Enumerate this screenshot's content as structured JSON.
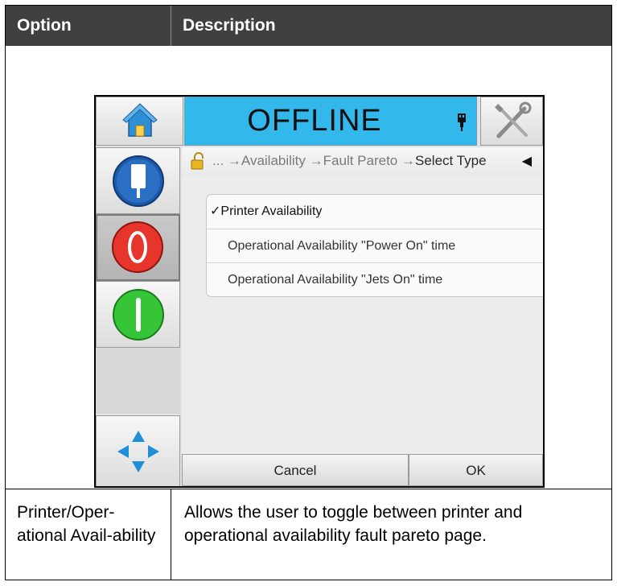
{
  "table": {
    "header_option": "Option",
    "header_description": "Description",
    "rows": [
      {
        "option": "Printer/Oper-ational Avail-ability",
        "description": "Allows the user to toggle between printer and operational availability fault pareto page."
      }
    ]
  },
  "screen": {
    "status": "OFFLINE",
    "breadcrumb": {
      "prefix": "...",
      "items": [
        "Availability",
        "Fault Pareto"
      ],
      "current": "Select Type"
    },
    "options": [
      {
        "label": "Printer Availability",
        "selected": true
      },
      {
        "label": "Operational Availability \"Power On\" time",
        "selected": false
      },
      {
        "label": "Operational Availability \"Jets On\" time",
        "selected": false
      }
    ],
    "check_mark": "✓",
    "buttons": {
      "cancel": "Cancel",
      "ok": "OK"
    },
    "colors": {
      "status_bar": "#33b8ec",
      "stop_button": "#e8352b",
      "start_button": "#35c537",
      "info_button": "#1f5aa8",
      "home_house": "#2d8fd6",
      "nav_arrows": "#1e8fd8"
    },
    "icons": [
      "home-icon",
      "usb-icon",
      "tools-icon",
      "padlock-icon",
      "back-arrow-icon",
      "printer-info-icon",
      "stop-icon",
      "start-icon",
      "navigation-arrows-icon"
    ]
  }
}
